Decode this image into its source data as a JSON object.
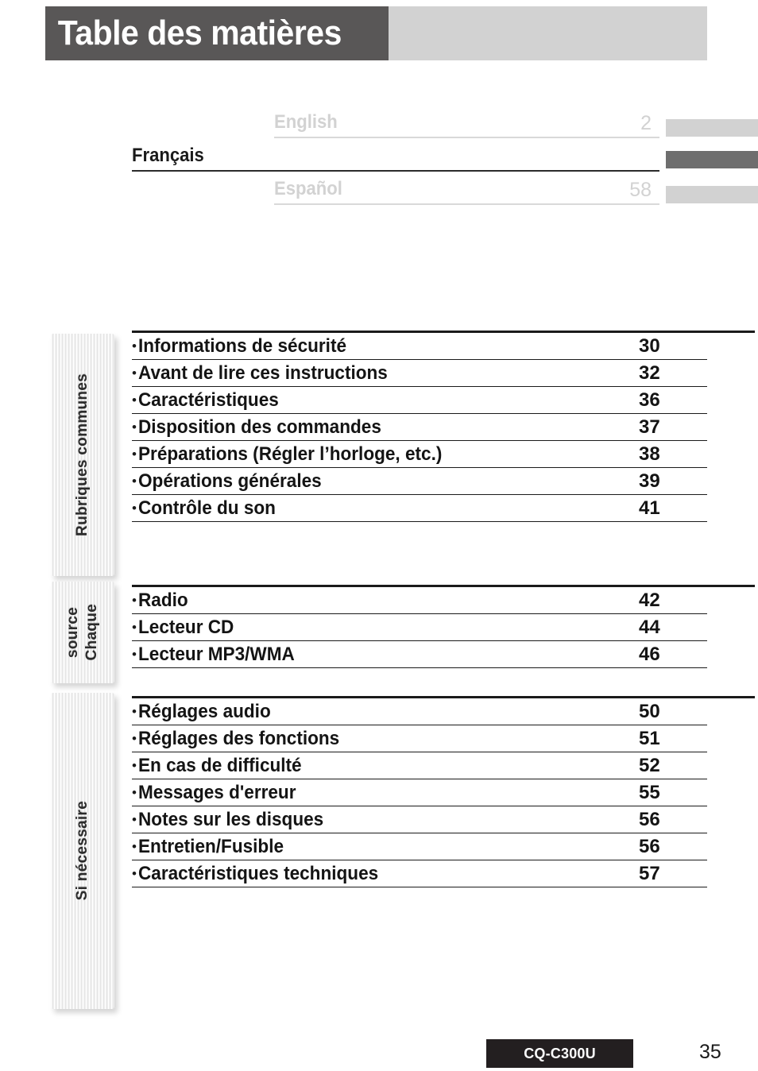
{
  "header": {
    "title": "Table des matières"
  },
  "languages": [
    {
      "label": "English",
      "page": "2",
      "active": false
    },
    {
      "label": "Français",
      "page": "",
      "active": true
    },
    {
      "label": "Español",
      "page": "58",
      "active": false
    }
  ],
  "sections": [
    {
      "tab_lines": [
        "Rubriques communes"
      ],
      "entries": [
        {
          "bullet": "•",
          "label": "Informations de sécurité",
          "page": "30"
        },
        {
          "bullet": "•",
          "label": "Avant de lire ces instructions",
          "page": "32"
        },
        {
          "bullet": "•",
          "label": "Caractéristiques",
          "page": "36"
        },
        {
          "bullet": "•",
          "label": "Disposition des commandes",
          "page": "37"
        },
        {
          "bullet": "•",
          "label": "Préparations (Régler l’horloge, etc.)",
          "page": "38"
        },
        {
          "bullet": "•",
          "label": "Opérations générales",
          "page": "39"
        },
        {
          "bullet": "•",
          "label": "Contrôle du son",
          "page": "41"
        }
      ]
    },
    {
      "tab_lines": [
        "Chaque",
        "source"
      ],
      "entries": [
        {
          "bullet": "•",
          "label": "Radio",
          "page": "42"
        },
        {
          "bullet": "•",
          "label": "Lecteur CD",
          "page": "44"
        },
        {
          "bullet": "•",
          "label": "Lecteur MP3/WMA",
          "page": "46"
        }
      ]
    },
    {
      "tab_lines": [
        "Si nécessaire"
      ],
      "entries": [
        {
          "bullet": "•",
          "label": "Réglages audio",
          "page": "50"
        },
        {
          "bullet": "•",
          "label": "Réglages des fonctions",
          "page": "51"
        },
        {
          "bullet": "•",
          "label": "En cas de difficulté",
          "page": "52"
        },
        {
          "bullet": "•",
          "label": "Messages d'erreur",
          "page": "55"
        },
        {
          "bullet": "•",
          "label": "Notes sur les disques",
          "page": "56"
        },
        {
          "bullet": "•",
          "label": "Entretien/Fusible",
          "page": "56"
        },
        {
          "bullet": "•",
          "label": "Caractéristiques techniques",
          "page": "57"
        }
      ]
    }
  ],
  "footer": {
    "model": "CQ-C300U",
    "page_number": "35"
  },
  "colors": {
    "header_dark": "#595757",
    "header_light": "#d2d2d2",
    "active_marker": "#6e6e6e",
    "inactive_marker": "#d2d2d2",
    "rule": "#1a1a1a",
    "badge_bg": "#231f20"
  }
}
